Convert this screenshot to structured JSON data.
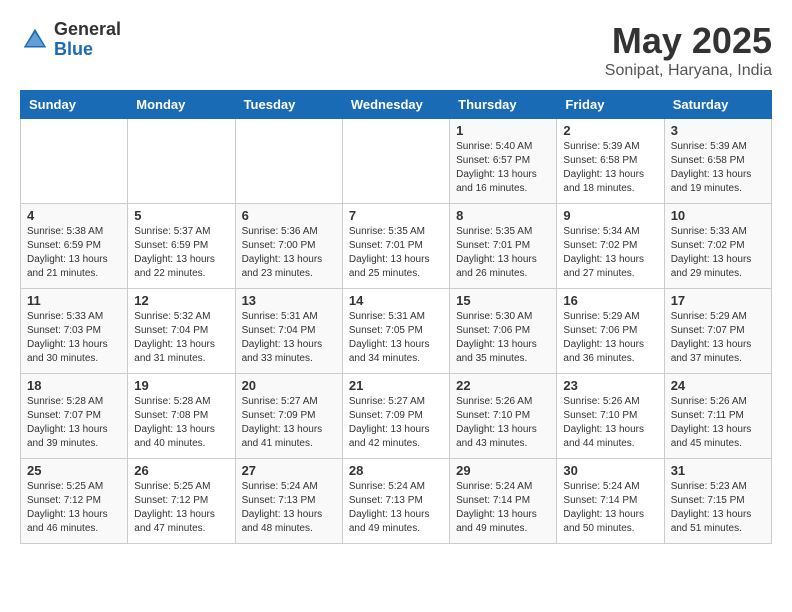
{
  "header": {
    "logo_general": "General",
    "logo_blue": "Blue",
    "month_title": "May 2025",
    "subtitle": "Sonipat, Haryana, India"
  },
  "days_of_week": [
    "Sunday",
    "Monday",
    "Tuesday",
    "Wednesday",
    "Thursday",
    "Friday",
    "Saturday"
  ],
  "weeks": [
    [
      {
        "day": "",
        "info": ""
      },
      {
        "day": "",
        "info": ""
      },
      {
        "day": "",
        "info": ""
      },
      {
        "day": "",
        "info": ""
      },
      {
        "day": "1",
        "info": "Sunrise: 5:40 AM\nSunset: 6:57 PM\nDaylight: 13 hours\nand 16 minutes."
      },
      {
        "day": "2",
        "info": "Sunrise: 5:39 AM\nSunset: 6:58 PM\nDaylight: 13 hours\nand 18 minutes."
      },
      {
        "day": "3",
        "info": "Sunrise: 5:39 AM\nSunset: 6:58 PM\nDaylight: 13 hours\nand 19 minutes."
      }
    ],
    [
      {
        "day": "4",
        "info": "Sunrise: 5:38 AM\nSunset: 6:59 PM\nDaylight: 13 hours\nand 21 minutes."
      },
      {
        "day": "5",
        "info": "Sunrise: 5:37 AM\nSunset: 6:59 PM\nDaylight: 13 hours\nand 22 minutes."
      },
      {
        "day": "6",
        "info": "Sunrise: 5:36 AM\nSunset: 7:00 PM\nDaylight: 13 hours\nand 23 minutes."
      },
      {
        "day": "7",
        "info": "Sunrise: 5:35 AM\nSunset: 7:01 PM\nDaylight: 13 hours\nand 25 minutes."
      },
      {
        "day": "8",
        "info": "Sunrise: 5:35 AM\nSunset: 7:01 PM\nDaylight: 13 hours\nand 26 minutes."
      },
      {
        "day": "9",
        "info": "Sunrise: 5:34 AM\nSunset: 7:02 PM\nDaylight: 13 hours\nand 27 minutes."
      },
      {
        "day": "10",
        "info": "Sunrise: 5:33 AM\nSunset: 7:02 PM\nDaylight: 13 hours\nand 29 minutes."
      }
    ],
    [
      {
        "day": "11",
        "info": "Sunrise: 5:33 AM\nSunset: 7:03 PM\nDaylight: 13 hours\nand 30 minutes."
      },
      {
        "day": "12",
        "info": "Sunrise: 5:32 AM\nSunset: 7:04 PM\nDaylight: 13 hours\nand 31 minutes."
      },
      {
        "day": "13",
        "info": "Sunrise: 5:31 AM\nSunset: 7:04 PM\nDaylight: 13 hours\nand 33 minutes."
      },
      {
        "day": "14",
        "info": "Sunrise: 5:31 AM\nSunset: 7:05 PM\nDaylight: 13 hours\nand 34 minutes."
      },
      {
        "day": "15",
        "info": "Sunrise: 5:30 AM\nSunset: 7:06 PM\nDaylight: 13 hours\nand 35 minutes."
      },
      {
        "day": "16",
        "info": "Sunrise: 5:29 AM\nSunset: 7:06 PM\nDaylight: 13 hours\nand 36 minutes."
      },
      {
        "day": "17",
        "info": "Sunrise: 5:29 AM\nSunset: 7:07 PM\nDaylight: 13 hours\nand 37 minutes."
      }
    ],
    [
      {
        "day": "18",
        "info": "Sunrise: 5:28 AM\nSunset: 7:07 PM\nDaylight: 13 hours\nand 39 minutes."
      },
      {
        "day": "19",
        "info": "Sunrise: 5:28 AM\nSunset: 7:08 PM\nDaylight: 13 hours\nand 40 minutes."
      },
      {
        "day": "20",
        "info": "Sunrise: 5:27 AM\nSunset: 7:09 PM\nDaylight: 13 hours\nand 41 minutes."
      },
      {
        "day": "21",
        "info": "Sunrise: 5:27 AM\nSunset: 7:09 PM\nDaylight: 13 hours\nand 42 minutes."
      },
      {
        "day": "22",
        "info": "Sunrise: 5:26 AM\nSunset: 7:10 PM\nDaylight: 13 hours\nand 43 minutes."
      },
      {
        "day": "23",
        "info": "Sunrise: 5:26 AM\nSunset: 7:10 PM\nDaylight: 13 hours\nand 44 minutes."
      },
      {
        "day": "24",
        "info": "Sunrise: 5:26 AM\nSunset: 7:11 PM\nDaylight: 13 hours\nand 45 minutes."
      }
    ],
    [
      {
        "day": "25",
        "info": "Sunrise: 5:25 AM\nSunset: 7:12 PM\nDaylight: 13 hours\nand 46 minutes."
      },
      {
        "day": "26",
        "info": "Sunrise: 5:25 AM\nSunset: 7:12 PM\nDaylight: 13 hours\nand 47 minutes."
      },
      {
        "day": "27",
        "info": "Sunrise: 5:24 AM\nSunset: 7:13 PM\nDaylight: 13 hours\nand 48 minutes."
      },
      {
        "day": "28",
        "info": "Sunrise: 5:24 AM\nSunset: 7:13 PM\nDaylight: 13 hours\nand 49 minutes."
      },
      {
        "day": "29",
        "info": "Sunrise: 5:24 AM\nSunset: 7:14 PM\nDaylight: 13 hours\nand 49 minutes."
      },
      {
        "day": "30",
        "info": "Sunrise: 5:24 AM\nSunset: 7:14 PM\nDaylight: 13 hours\nand 50 minutes."
      },
      {
        "day": "31",
        "info": "Sunrise: 5:23 AM\nSunset: 7:15 PM\nDaylight: 13 hours\nand 51 minutes."
      }
    ]
  ]
}
